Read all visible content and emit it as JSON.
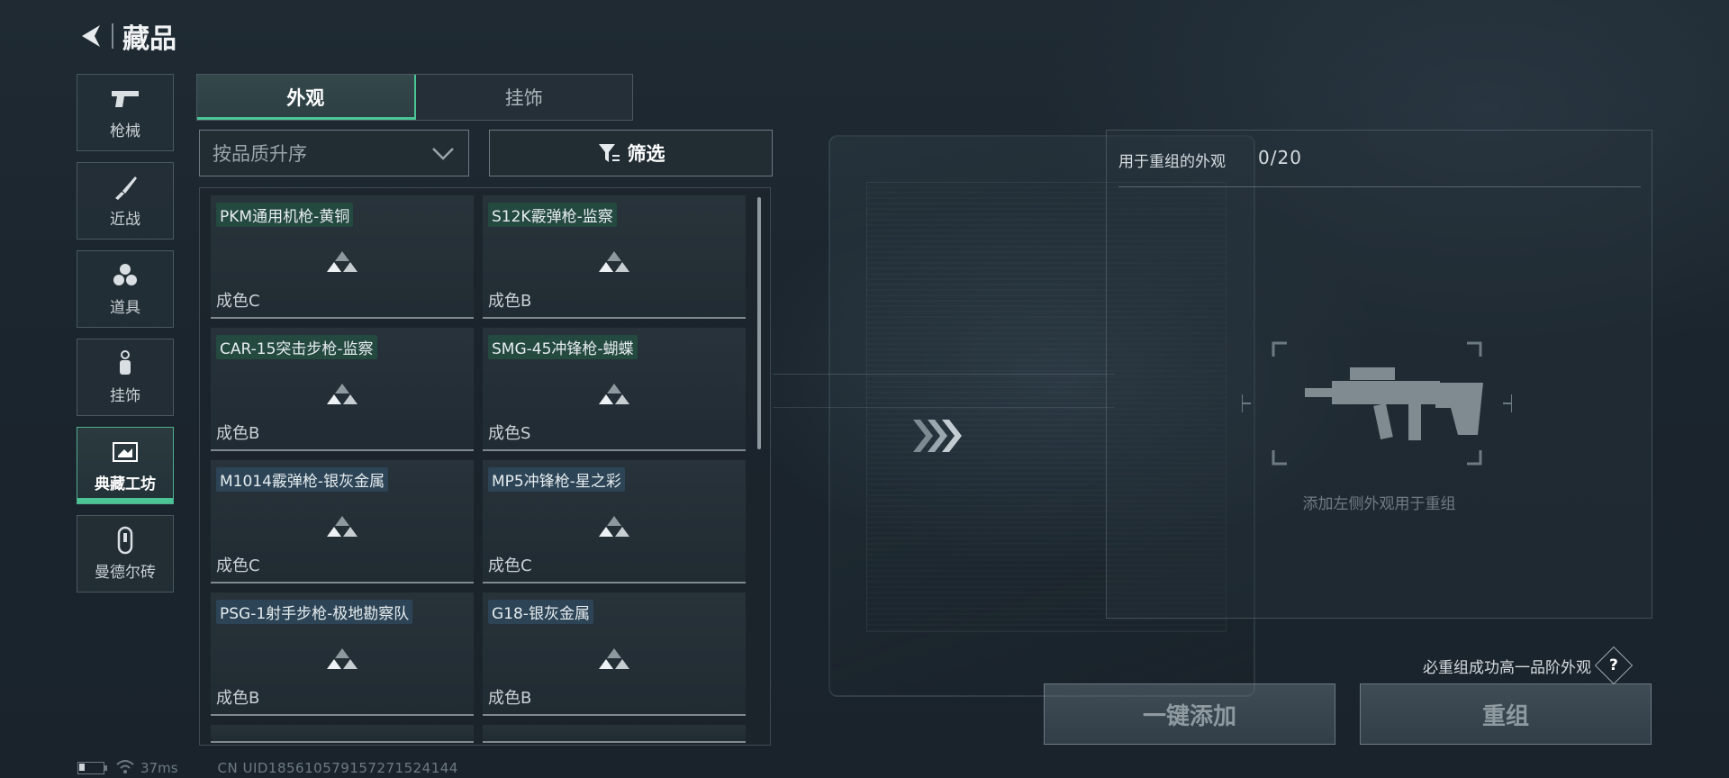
{
  "header": {
    "title": "藏品"
  },
  "sidebar": {
    "items": [
      {
        "label": "枪械",
        "icon": "pistol-icon",
        "active": false
      },
      {
        "label": "近战",
        "icon": "knife-icon",
        "active": false
      },
      {
        "label": "道具",
        "icon": "grenades-icon",
        "active": false
      },
      {
        "label": "挂饰",
        "icon": "charm-icon",
        "active": false
      },
      {
        "label": "典藏工坊",
        "icon": "workshop-icon",
        "active": true
      },
      {
        "label": "曼德尔砖",
        "icon": "brick-icon",
        "active": false
      }
    ]
  },
  "tabs": [
    {
      "label": "外观",
      "active": true
    },
    {
      "label": "挂饰",
      "active": false
    }
  ],
  "sort": {
    "value": "按品质升序"
  },
  "filter": {
    "label": "筛选"
  },
  "items": [
    {
      "name": "PKM通用机枪-黄铜",
      "grade": "成色C",
      "tag_color": "green"
    },
    {
      "name": "S12K霰弹枪-监察",
      "grade": "成色B",
      "tag_color": "green"
    },
    {
      "name": "CAR-15突击步枪-监察",
      "grade": "成色B",
      "tag_color": "green"
    },
    {
      "name": "SMG-45冲锋枪-蝴蝶",
      "grade": "成色S",
      "tag_color": "green"
    },
    {
      "name": "M1014霰弹枪-银灰金属",
      "grade": "成色C",
      "tag_color": "blue"
    },
    {
      "name": "MP5冲锋枪-星之彩",
      "grade": "成色C",
      "tag_color": "blue"
    },
    {
      "name": "PSG-1射手步枪-极地勘察队",
      "grade": "成色B",
      "tag_color": "blue"
    },
    {
      "name": "G18-银灰金属",
      "grade": "成色B",
      "tag_color": "blue"
    }
  ],
  "recombine": {
    "title": "用于重组的外观",
    "count": "0/20",
    "empty_hint": "添加左侧外观用于重组",
    "guarantee_hint": "必重组成功高一品阶外观",
    "help": "?",
    "add_all_label": "一键添加",
    "recombine_label": "重组"
  },
  "status": {
    "ping": "37ms",
    "uid": "CN UID185610579157271524144"
  },
  "colors": {
    "accent": "#4cc596",
    "tag_green": "#24493f",
    "tag_blue": "#2c4456"
  }
}
